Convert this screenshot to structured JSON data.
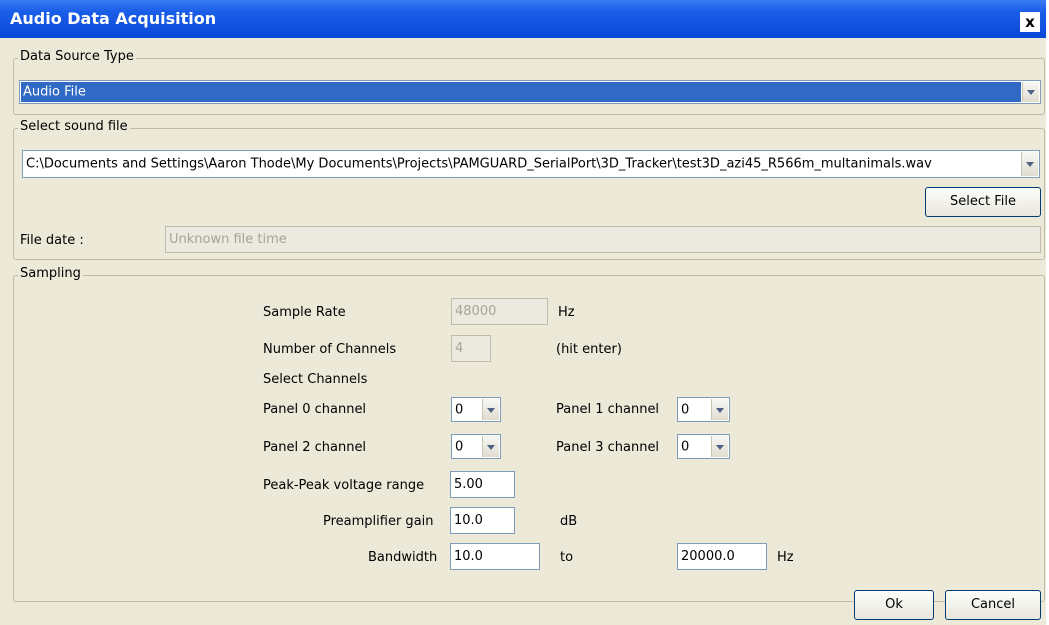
{
  "window": {
    "title": "Audio Data Acquisition",
    "close_label": "x"
  },
  "data_source": {
    "group_label": "Data Source Type",
    "selected": "Audio File"
  },
  "sound_file": {
    "group_label": "Select sound file",
    "path": "C:\\Documents and Settings\\Aaron Thode\\My Documents\\Projects\\PAMGUARD_SerialPort\\3D_Tracker\\test3D_azi45_R566m_multanimals.wav",
    "select_button": "Select File",
    "file_date_label": "File date :",
    "file_date_value": "Unknown file time"
  },
  "sampling": {
    "group_label": "Sampling",
    "sample_rate_label": "Sample Rate",
    "sample_rate_value": "48000",
    "sample_rate_unit": "Hz",
    "channels_label": "Number of Channels",
    "channels_value": "4",
    "channels_hint": "(hit enter)",
    "select_channels_label": "Select Channels",
    "panel0_label": "Panel 0 channel",
    "panel0_value": "0",
    "panel1_label": "Panel 1 channel",
    "panel1_value": "0",
    "panel2_label": "Panel 2 channel",
    "panel2_value": "0",
    "panel3_label": "Panel 3 channel",
    "panel3_value": "0",
    "voltage_label": "Peak-Peak voltage range",
    "voltage_value": "5.00",
    "gain_label": "Preamplifier gain",
    "gain_value": "10.0",
    "gain_unit": "dB",
    "bandwidth_label": "Bandwidth",
    "bandwidth_low": "10.0",
    "bandwidth_to": "to",
    "bandwidth_high": "20000.0",
    "bandwidth_unit": "Hz"
  },
  "buttons": {
    "ok": "Ok",
    "cancel": "Cancel"
  }
}
